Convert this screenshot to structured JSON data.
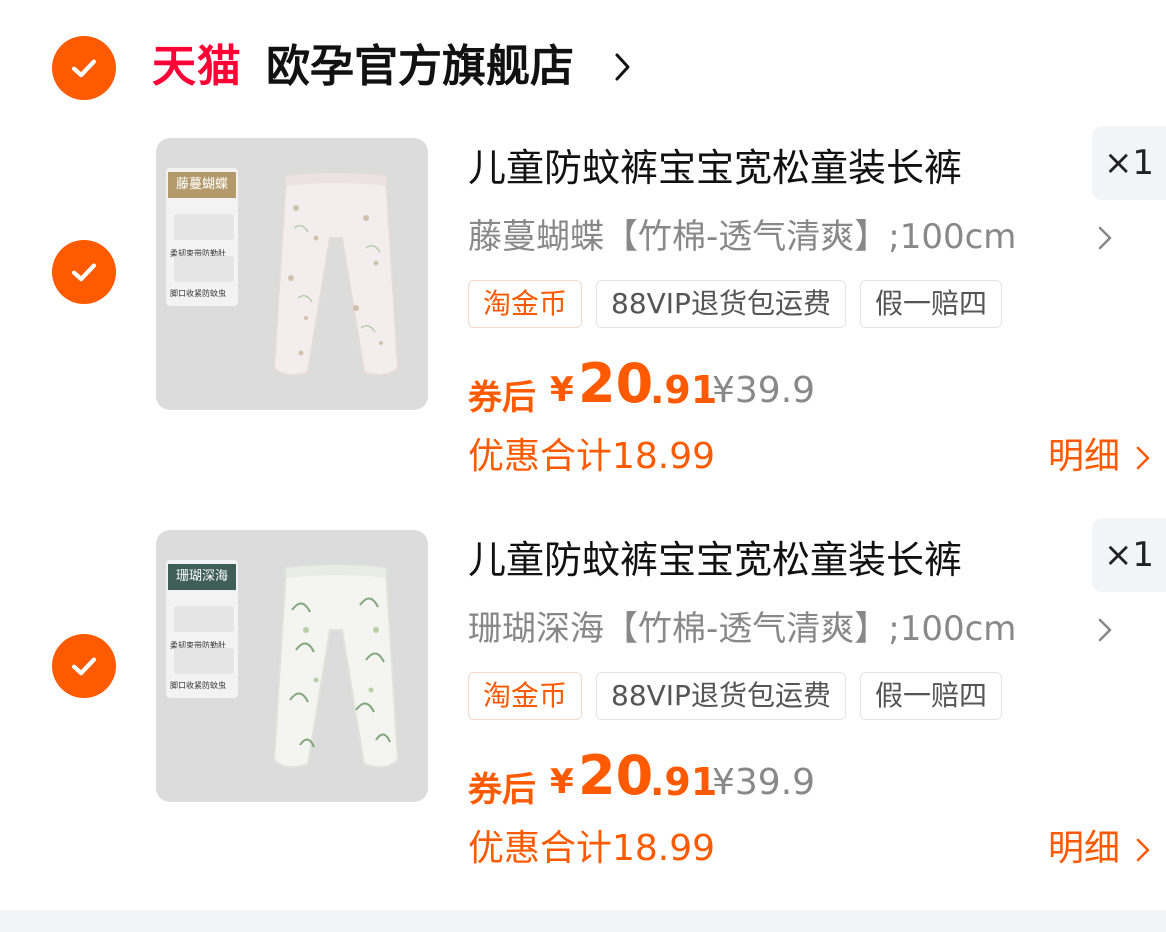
{
  "store": {
    "brand_label": "天猫",
    "name": "欧孕官方旗舰店"
  },
  "colors": {
    "accent": "#ff5a00",
    "tmall_red": "#ff0036",
    "muted": "#888888"
  },
  "items": [
    {
      "title": "儿童防蚊裤宝宝宽松童装长裤",
      "quantity": "×1",
      "sku": "藤蔓蝴蝶【竹棉-透气清爽】;100cm",
      "tags": [
        "淘金币",
        "88VIP退货包运费",
        "假一赔四"
      ],
      "price_label": "券后",
      "price_symbol": "¥",
      "price_integer": "20",
      "price_decimal": ".91",
      "original_price": "¥39.9",
      "discount_text": "优惠合计18.99",
      "detail_label": "明细",
      "thumb": {
        "tag": "藤蔓蝴蝶",
        "tag_color": "#b49a6a",
        "line1": "柔韧束带防勒肚",
        "line2": "脚口收紧防蚊虫"
      }
    },
    {
      "title": "儿童防蚊裤宝宝宽松童装长裤",
      "quantity": "×1",
      "sku": "珊瑚深海【竹棉-透气清爽】;100cm",
      "tags": [
        "淘金币",
        "88VIP退货包运费",
        "假一赔四"
      ],
      "price_label": "券后",
      "price_symbol": "¥",
      "price_integer": "20",
      "price_decimal": ".91",
      "original_price": "¥39.9",
      "discount_text": "优惠合计18.99",
      "detail_label": "明细",
      "thumb": {
        "tag": "珊瑚深海",
        "tag_color": "#3f5e58",
        "line1": "柔韧束带防勒肚",
        "line2": "脚口收紧防蚊虫"
      }
    }
  ]
}
